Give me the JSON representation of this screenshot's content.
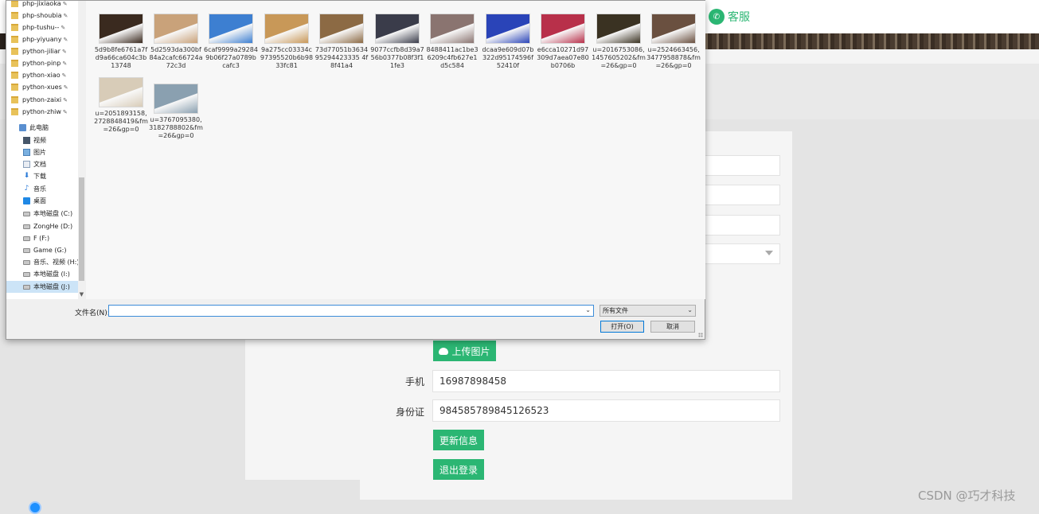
{
  "site": {
    "service_label": "客服",
    "service_icon": "wechat-icon",
    "upload_button": "上传图片",
    "phone_label": "手机",
    "phone_value": "16987898458",
    "id_label": "身份证",
    "id_value": "984585789845126523",
    "update_button": "更新信息",
    "logout_button": "退出登录",
    "watermark": "CSDN @巧才科技",
    "accent_color": "#2bb673"
  },
  "dialog": {
    "quick_access": [
      {
        "label": "php-jixiaoka"
      },
      {
        "label": "php-shoubia"
      },
      {
        "label": "php-tushu--"
      },
      {
        "label": "php-yiyuany"
      },
      {
        "label": "python-jiliar"
      },
      {
        "label": "python-pinp"
      },
      {
        "label": "python-xiao"
      },
      {
        "label": "python-xues"
      },
      {
        "label": "python-zaixi"
      },
      {
        "label": "python-zhiw"
      }
    ],
    "this_pc": "此电脑",
    "places": [
      {
        "label": "视频",
        "icon": "video-icon"
      },
      {
        "label": "图片",
        "icon": "pictures-icon"
      },
      {
        "label": "文档",
        "icon": "documents-icon"
      },
      {
        "label": "下载",
        "icon": "download-icon"
      },
      {
        "label": "音乐",
        "icon": "music-icon"
      },
      {
        "label": "桌面",
        "icon": "desktop-icon"
      }
    ],
    "drives": [
      {
        "label": "本地磁盘 (C:)"
      },
      {
        "label": "ZongHe (D:)"
      },
      {
        "label": "F (F:)"
      },
      {
        "label": "Game (G:)"
      },
      {
        "label": "音乐、视频 (H:)"
      },
      {
        "label": "本地磁盘 (I:)"
      },
      {
        "label": "本地磁盘 (J:)"
      }
    ],
    "files": [
      {
        "name": "5d9b8fe6761a7fd9a66ca604c3b13748",
        "color": "#3a2a1f"
      },
      {
        "name": "5d2593da300bf84a2cafc66724a72c3d",
        "color": "#c9a27a"
      },
      {
        "name": "6caf9999a292849b06f27a0789bcafc3",
        "color": "#3d7fd1"
      },
      {
        "name": "9a275cc03334c97395520b6b9833fc81",
        "color": "#c89858"
      },
      {
        "name": "73d77051b363495294423335 4f8f41a4",
        "color": "#8c6a44"
      },
      {
        "name": "9077ccfb8d39a756b0377b08f3f11fe3",
        "color": "#3a3c4a"
      },
      {
        "name": "8488411ac1be36209c4fb627e1d5c584",
        "color": "#8a7470"
      },
      {
        "name": "dcaa9e609d07b322d95174596f52410f",
        "color": "#2a44b8"
      },
      {
        "name": "e6cca10271d97309d7aea07e80b0706b",
        "color": "#b8304a"
      },
      {
        "name": "u=2016753086,1457605202&fm=26&gp=0",
        "color": "#3a3222"
      },
      {
        "name": "u=2524663456,3477958878&fm=26&gp=0",
        "color": "#6a5040"
      },
      {
        "name": "u=2051893158,2728848419&fm=26&gp=0",
        "color": "#d8ccb8"
      },
      {
        "name": "u=3767095380,3182788802&fm=26&gp=0",
        "color": "#8aa0b0"
      }
    ],
    "filename_label": "文件名(N):",
    "filename_value": "",
    "filter_value": "所有文件",
    "open_button": "打开(O)",
    "cancel_button": "取消"
  }
}
